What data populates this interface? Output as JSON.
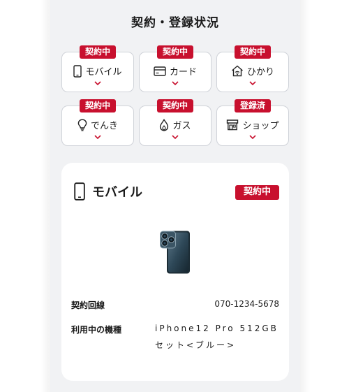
{
  "section_title": "契約・登録状況",
  "services": [
    {
      "badge": "契約中",
      "label": "モバイル",
      "icon": "smartphone-icon"
    },
    {
      "badge": "契約中",
      "label": "カード",
      "icon": "credit-card-icon"
    },
    {
      "badge": "契約中",
      "label": "ひかり",
      "icon": "home-wifi-icon"
    },
    {
      "badge": "契約中",
      "label": "でんき",
      "icon": "lightbulb-icon"
    },
    {
      "badge": "契約中",
      "label": "ガス",
      "icon": "flame-icon"
    },
    {
      "badge": "登録済",
      "label": "ショップ",
      "icon": "shop-icon"
    }
  ],
  "detail": {
    "title": "モバイル",
    "status": "契約中",
    "line_label": "契約回線",
    "line_value": "070-1234-5678",
    "device_label": "利用中の機種",
    "device_value": "iPhone12 Pro 512GBセット<ブルー>"
  },
  "colors": {
    "accent": "#c8102e",
    "panel_bg": "#f1f2f4"
  }
}
